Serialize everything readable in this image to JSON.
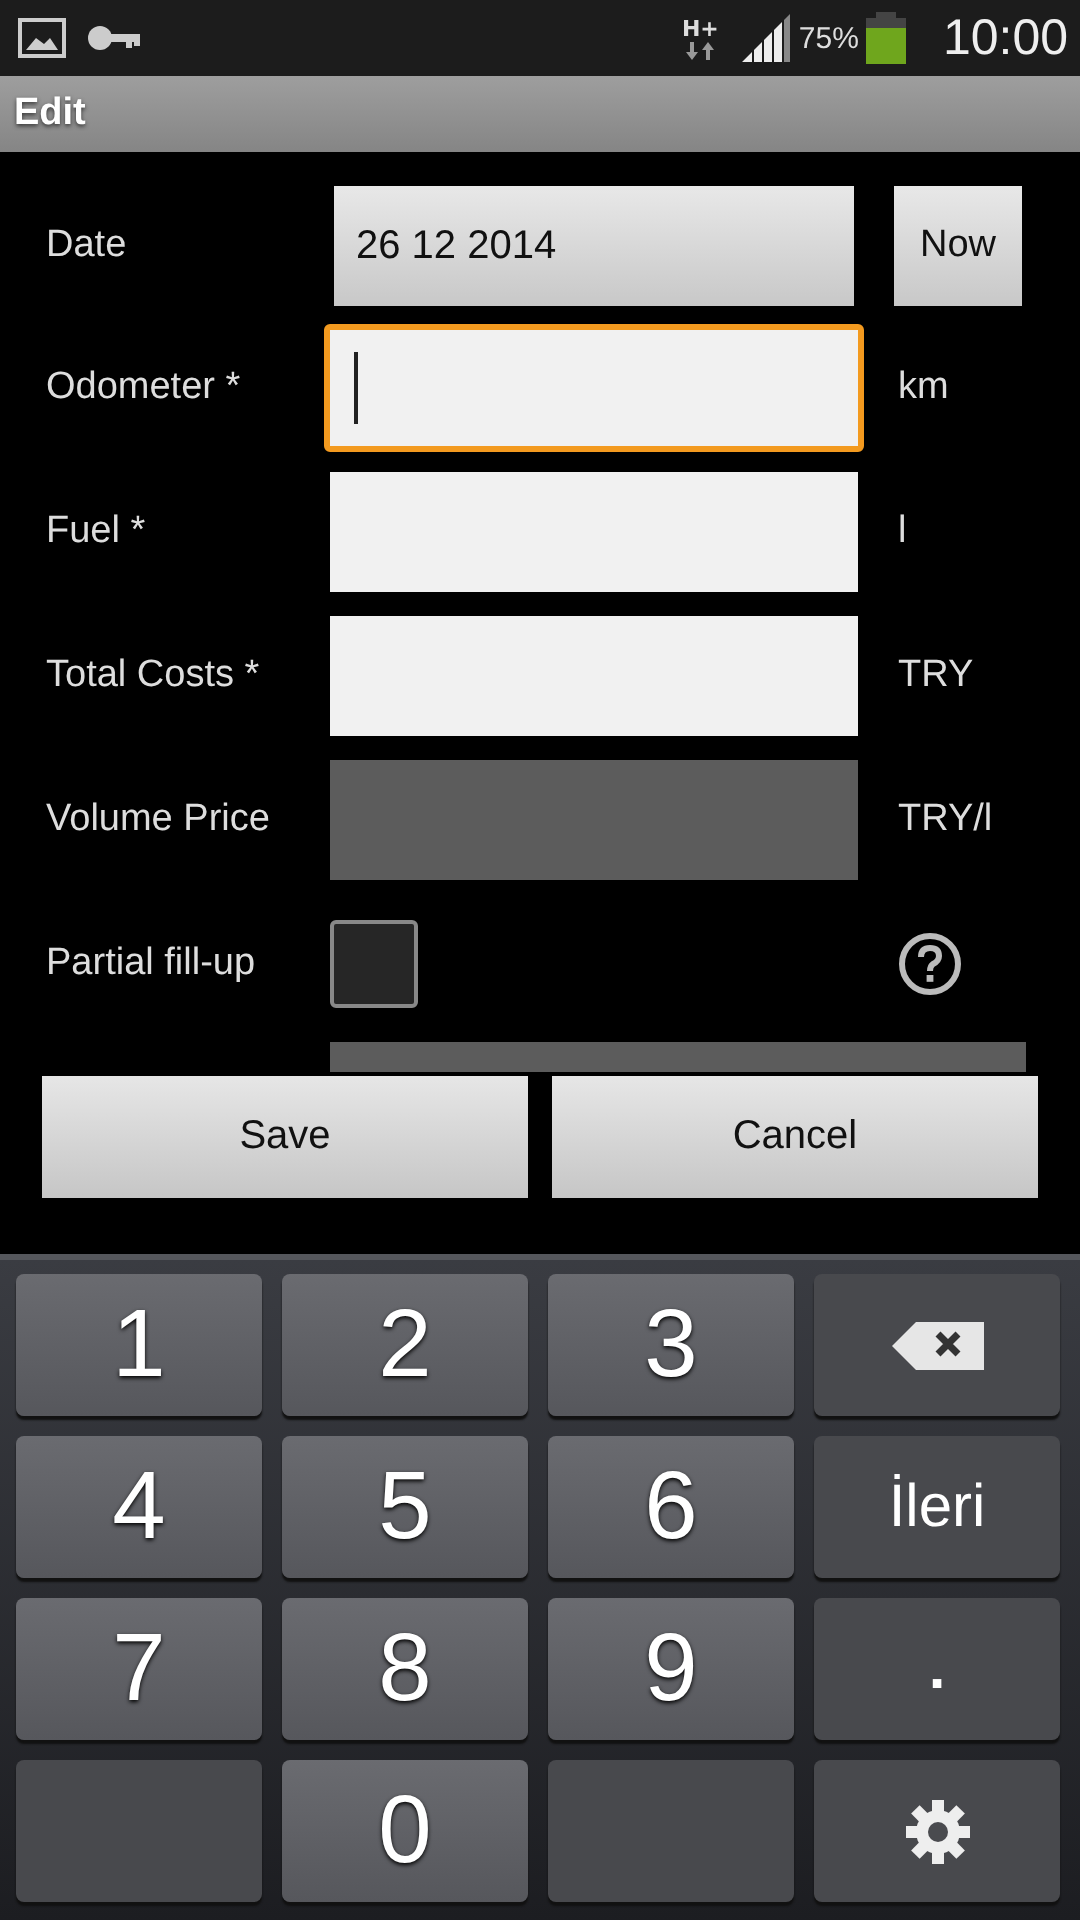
{
  "status_bar": {
    "network": "H+",
    "battery": "75%",
    "time": "10:00"
  },
  "title": "Edit",
  "fields": [
    {
      "label": "Date",
      "kind": "date",
      "value": "26 12 2014",
      "button": "Now"
    },
    {
      "label": "Odometer *",
      "kind": "input",
      "focused": true,
      "disabled": false,
      "unit": "km"
    },
    {
      "label": "Fuel *",
      "kind": "input",
      "focused": false,
      "disabled": false,
      "unit": "l"
    },
    {
      "label": "Total Costs *",
      "kind": "input",
      "focused": false,
      "disabled": false,
      "unit": "TRY"
    },
    {
      "label": "Volume Price",
      "kind": "input",
      "focused": false,
      "disabled": true,
      "unit": "TRY/l"
    },
    {
      "label": "Partial fill-up",
      "kind": "checkbox",
      "checked": false
    }
  ],
  "buttons": [
    "Save",
    "Cancel"
  ],
  "keyboard": [
    {
      "kind": "digit",
      "label": "1"
    },
    {
      "kind": "digit",
      "label": "2"
    },
    {
      "kind": "digit",
      "label": "3"
    },
    {
      "kind": "backspace"
    },
    {
      "kind": "digit",
      "label": "4"
    },
    {
      "kind": "digit",
      "label": "5"
    },
    {
      "kind": "digit",
      "label": "6"
    },
    {
      "kind": "action",
      "label": "İleri"
    },
    {
      "kind": "digit",
      "label": "7"
    },
    {
      "kind": "digit",
      "label": "8"
    },
    {
      "kind": "digit",
      "label": "9"
    },
    {
      "kind": "symbol",
      "label": "."
    },
    {
      "kind": "blank"
    },
    {
      "kind": "digit",
      "label": "0"
    },
    {
      "kind": "blank"
    },
    {
      "kind": "settings"
    }
  ]
}
